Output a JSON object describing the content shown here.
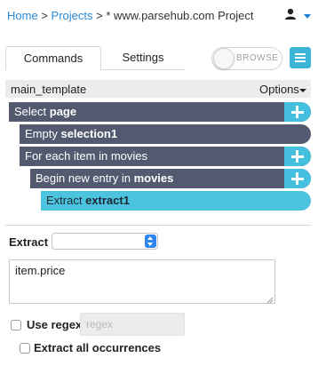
{
  "breadcrumb": {
    "home": "Home",
    "sep1": ">",
    "projects": "Projects",
    "sep2": ">",
    "current": "* www.parsehub.com Project"
  },
  "header": {
    "user_icon": "user-icon",
    "dropdown_icon": "caret-down-icon"
  },
  "tabs": [
    {
      "label": "Commands",
      "active": true
    },
    {
      "label": "Settings",
      "active": false
    }
  ],
  "browse_toggle": {
    "label": "BROWSE",
    "on": false
  },
  "template": {
    "name": "main_template",
    "options_label": "Options"
  },
  "commands": [
    {
      "prefix": "Select ",
      "name": "page",
      "has_add": true
    },
    {
      "prefix": "Empty ",
      "name": "selection1",
      "has_add": false
    },
    {
      "prefix": "For each item in ",
      "name": "movies",
      "name_bold": false,
      "has_add": true
    },
    {
      "prefix": "Begin new entry in ",
      "name": "movies",
      "has_add": true
    },
    {
      "prefix": "Extract ",
      "name": "extract1",
      "has_add": false,
      "selected": true
    }
  ],
  "extract": {
    "label": "Extract",
    "select_value": "",
    "expression": "item.price",
    "use_regex_label": "Use regex",
    "regex_placeholder": "regex",
    "use_regex_checked": false,
    "extract_all_label": "Extract all occurrences",
    "extract_all_checked": false
  },
  "colors": {
    "link": "#2a8ad4",
    "command_dark": "#535a70",
    "command_selected": "#4cc4e0",
    "add_button": "#44c0de",
    "menu_button": "#3bb6d6"
  }
}
